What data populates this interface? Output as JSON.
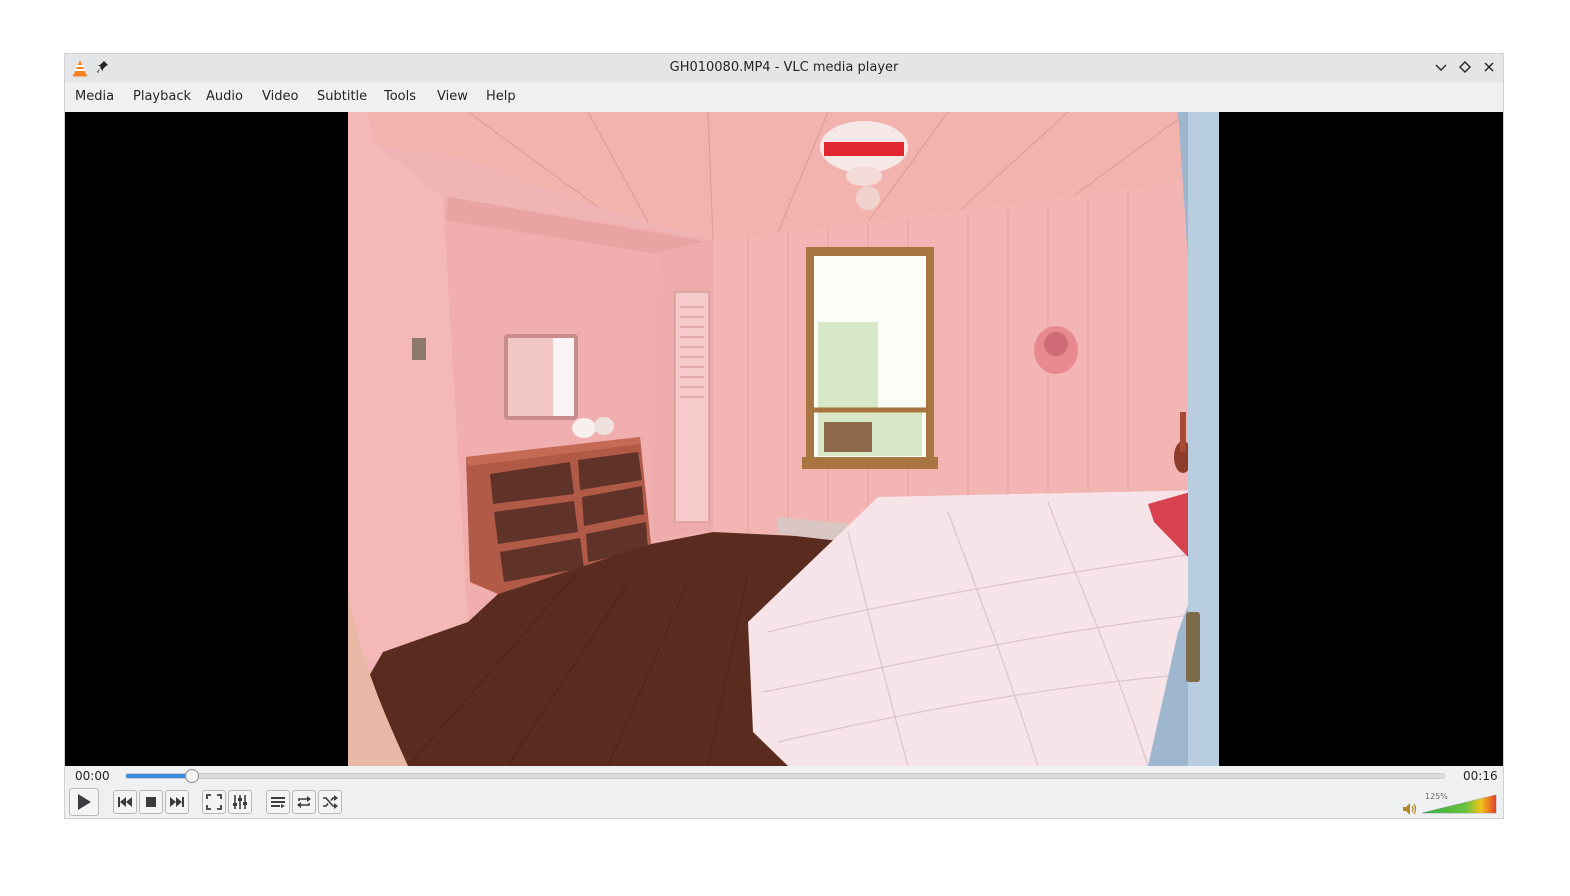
{
  "window": {
    "title": "GH010080.MP4 - VLC media player"
  },
  "menu": [
    "Media",
    "Playback",
    "Audio",
    "Video",
    "Subtitle",
    "Tools",
    "View",
    "Help"
  ],
  "playback": {
    "elapsed": "00:00",
    "total": "00:16",
    "progress_fraction": 0.05
  },
  "volume": {
    "label": "125%",
    "level_fraction": 1.0
  },
  "colors": {
    "accent": "#3d8be0",
    "vlc_orange": "#f58220"
  }
}
